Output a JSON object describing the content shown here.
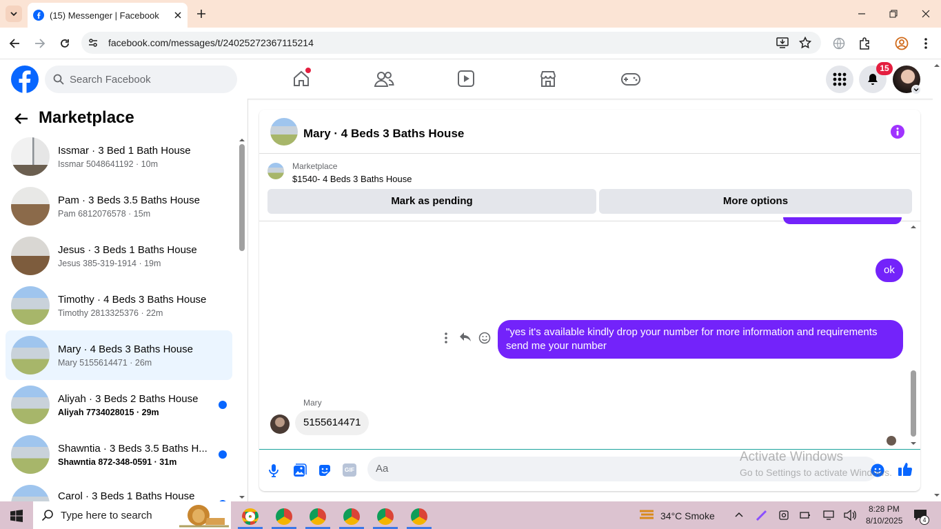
{
  "browser": {
    "tab_title": "(15) Messenger | Facebook",
    "url": "facebook.com/messages/t/24025272367115214"
  },
  "header": {
    "search_placeholder": "Search Facebook",
    "notification_count": "15"
  },
  "sidebar": {
    "title": "Marketplace",
    "items": [
      {
        "name": "Issmar · 3 Bed 1 Bath House",
        "sub": "Issmar 5048641192 · 10m",
        "unread": false,
        "selected": false
      },
      {
        "name": "Pam · 3 Beds 3.5 Baths House",
        "sub": "Pam 6812076578 · 15m",
        "unread": false,
        "selected": false
      },
      {
        "name": "Jesus · 3 Beds 1 Baths House",
        "sub": "Jesus 385-319-1914 · 19m",
        "unread": false,
        "selected": false
      },
      {
        "name": "Timothy · 4 Beds 3 Baths House",
        "sub": "Timothy 2813325376 · 22m",
        "unread": false,
        "selected": false
      },
      {
        "name": "Mary · 4 Beds 3 Baths House",
        "sub": "Mary 5155614471 · 26m",
        "unread": false,
        "selected": true
      },
      {
        "name": "Aliyah · 3 Beds 2 Baths House",
        "sub": "Aliyah 7734028015 · 29m",
        "unread": true,
        "selected": false
      },
      {
        "name": "Shawntia · 3 Beds 3.5 Baths H...",
        "sub": "Shawntia 872-348-0591 · 31m",
        "unread": true,
        "selected": false
      },
      {
        "name": "Carol · 3 Beds 1 Baths House",
        "sub": "",
        "unread": true,
        "selected": false
      }
    ]
  },
  "chat": {
    "title": "Mary · 4 Beds 3 Baths House",
    "marketplace_label": "Marketplace",
    "listing": "$1540- 4 Beds 3 Baths House",
    "mark_pending": "Mark as pending",
    "more_options": "More options",
    "msg_ok": "ok",
    "msg_long": "\"yes it's available kindly drop your number for more information and requirements send me your number",
    "sender_name": "Mary",
    "msg_reply": "5155614471",
    "composer_placeholder": "Aa"
  },
  "watermark": {
    "line1": "Activate Windows",
    "line2": "Go to Settings to activate Windows."
  },
  "taskbar": {
    "search_placeholder": "Type here to search",
    "weather": "34°C  Smoke",
    "time": "8:28 PM",
    "date": "8/10/2025",
    "notif_count": "4"
  },
  "colors": {
    "fb_blue": "#0866ff",
    "message_purple": "#7323fa",
    "tab_strip": "#fbe4d5",
    "taskbar": "#dcc3d0"
  }
}
